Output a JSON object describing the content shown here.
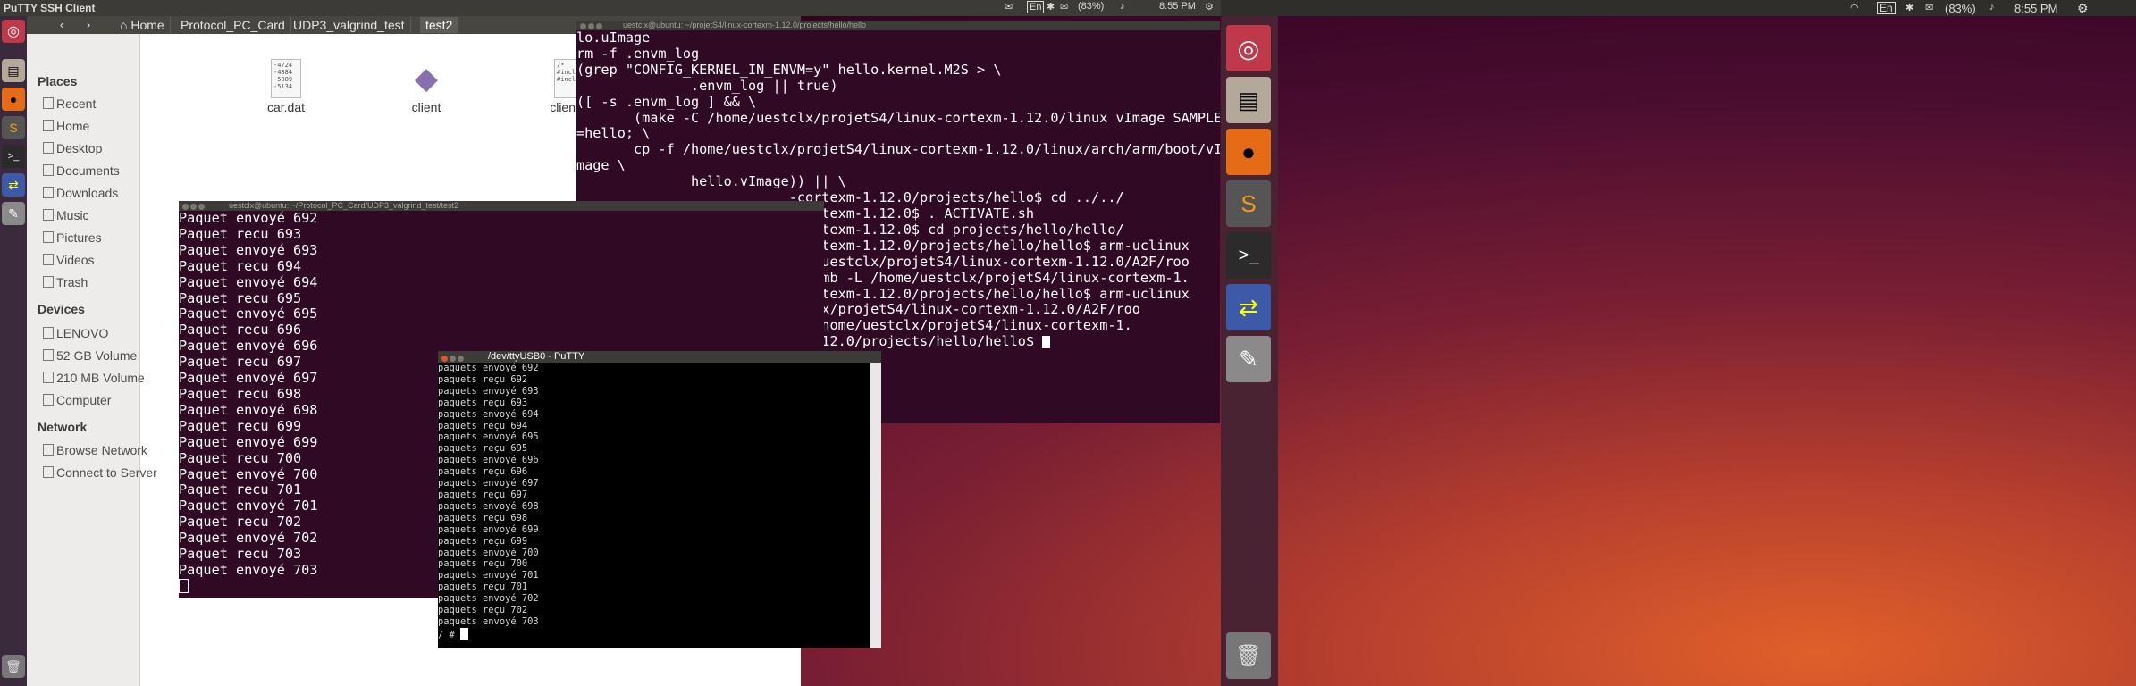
{
  "left_panel": {
    "title": "PuTTY SSH Client"
  },
  "right_panel": {
    "lang": "En",
    "battery": "(83%)",
    "clock": "8:55 PM"
  },
  "mid_panel": {
    "terminal_title": "uestclx@ubuntu: ~/projetS4/linux-cortexm-1.12.0/projects/hello/hello",
    "lang": "En",
    "battery": "(83%)",
    "clock": "8:55 PM"
  },
  "file_manager": {
    "breadcrumbs": [
      "Home",
      "Protocol_PC_Card",
      "UDP3_valgrind_test",
      "test2"
    ],
    "sidebar": {
      "places_heading": "Places",
      "places": [
        "Recent",
        "Home",
        "Desktop",
        "Documents",
        "Downloads",
        "Music",
        "Pictures",
        "Videos",
        "Trash"
      ],
      "devices_heading": "Devices",
      "devices": [
        "LENOVO",
        "52 GB Volume",
        "210 MB Volume",
        "Computer"
      ],
      "network_heading": "Network",
      "network": [
        "Browse Network",
        "Connect to Server"
      ]
    },
    "files": [
      {
        "name": "car.dat",
        "preview": "-4724\n-4884\n-5089\n-5134"
      },
      {
        "name": "client",
        "preview": ""
      },
      {
        "name": "client.c",
        "preview": "/*\n#incl\n#incl"
      }
    ]
  },
  "term_build": {
    "title": "uestclx@ubuntu: ~/projetS4/linux-cortexm-1.12.0/projects/hello/hello",
    "lines": [
      "lo.uImage",
      "rm -f .envm_log",
      "(grep \"CONFIG_KERNEL_IN_ENVM=y\" hello.kernel.M2S > \\",
      "              .envm_log || true)",
      "([ -s .envm_log ] && \\",
      "       (make -C /home/uestclx/projetS4/linux-cortexm-1.12.0/linux vImage SAMPLE",
      "=hello; \\",
      "       cp -f /home/uestclx/projetS4/linux-cortexm-1.12.0/linux/arch/arm/boot/vI",
      "mage \\",
      "              hello.vImage)) || \\",
      "",
      "",
      "                          -cortexm-1.12.0/projects/hello$ cd ../../",
      "                          -cortexm-1.12.0$ . ACTIVATE.sh",
      "                          -cortexm-1.12.0$ cd projects/hello/hello/",
      "                          -cortexm-1.12.0/projects/hello/hello$ arm-uclinux",
      "                          ome/uestclx/projetS4/linux-cortexm-1.12.0/A2F/roo",
      "                          mthumb -L /home/uestclx/projetS4/linux-cortexm-1.",
      "",
      "                          -cortexm-1.12.0/projects/hello/hello$ arm-uclinux",
      "                          stclx/projetS4/linux-cortexm-1.12.0/A2F/roo",
      "                          -L /home/uestclx/projetS4/linux-cortexm-1.",
      "",
      "                          m-1.12.0/projects/hello/hello$ "
    ]
  },
  "term_udp": {
    "title": "uestclx@ubuntu: ~/Protocol_PC_Card/UDP3_valgrind_test/test2",
    "lines": [
      "Paquet envoyé 692",
      "Paquet recu 693",
      "Paquet envoyé 693",
      "Paquet recu 694",
      "Paquet envoyé 694",
      "Paquet recu 695",
      "Paquet envoyé 695",
      "Paquet recu 696",
      "Paquet envoyé 696",
      "Paquet recu 697",
      "Paquet envoyé 697",
      "Paquet recu 698",
      "Paquet envoyé 698",
      "Paquet recu 699",
      "Paquet envoyé 699",
      "Paquet recu 700",
      "Paquet envoyé 700",
      "Paquet recu 701",
      "Paquet envoyé 701",
      "Paquet recu 702",
      "Paquet envoyé 702",
      "Paquet recu 703",
      "Paquet envoyé 703"
    ]
  },
  "putty": {
    "title": "/dev/ttyUSB0 - PuTTY",
    "lines": [
      "paquets envoyé 692",
      "paquets reçu 692",
      "paquets envoyé 693",
      "paquets reçu 693",
      "paquets envoyé 694",
      "paquets reçu 694",
      "paquets envoyé 695",
      "paquets reçu 695",
      "paquets envoyé 696",
      "paquets reçu 696",
      "paquets envoyé 697",
      "paquets reçu 697",
      "paquets envoyé 698",
      "paquets reçu 698",
      "paquets envoyé 699",
      "paquets reçu 699",
      "paquets envoyé 700",
      "paquets reçu 700",
      "paquets envoyé 701",
      "paquets reçu 701",
      "paquets envoyé 702",
      "paquets reçu 702",
      "paquets envoyé 703",
      "/ # "
    ]
  },
  "launcher_icons": [
    "ubuntu-dash-icon",
    "files-icon",
    "firefox-icon",
    "sublime-icon",
    "terminal-icon",
    "network-transfer-icon",
    "text-editor-icon",
    "trash-icon"
  ],
  "colors": {
    "terminal_bg": "#300a24",
    "panel_bg": "#3c3b37",
    "close_button": "#e6532b"
  }
}
